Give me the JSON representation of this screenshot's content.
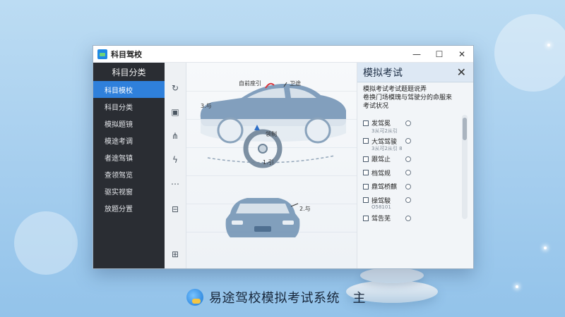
{
  "window": {
    "title": "科目驾校",
    "controls": {
      "minimize": "—",
      "maximize": "☐",
      "close": "✕"
    }
  },
  "sidebar": {
    "header": "科目分类",
    "items": [
      {
        "label": "科目模校",
        "active": true
      },
      {
        "label": "科目分类",
        "active": false
      },
      {
        "label": "模拟题镜",
        "active": false
      },
      {
        "label": "模途考调",
        "active": false
      },
      {
        "label": "者途驾镇",
        "active": false
      },
      {
        "label": "查领驾览",
        "active": false
      },
      {
        "label": "驱实视窗",
        "active": false
      },
      {
        "label": "放题分置",
        "active": false
      }
    ]
  },
  "toolstrip": {
    "icons": [
      "refresh-icon",
      "save-icon",
      "adjust-icon",
      "flash-icon",
      "more-icon",
      "monitor-icon",
      "grid-icon"
    ]
  },
  "canvas": {
    "callouts": {
      "roof_label": "自前座引",
      "mirror_label": "卫途",
      "side_label": "3.与",
      "wheel_center_label": "领制",
      "wheel_bottom_label": "1.引",
      "front_label": "2.与"
    },
    "colors": {
      "car_body": "#6d8fb2",
      "car_light": "#d7e1ea",
      "accent_red": "#d9363e",
      "wheel_blue": "#2f6fc7"
    }
  },
  "panel": {
    "title": "模拟考试",
    "close": "✕",
    "description": [
      "模拟考试考试题题说弄",
      "卷换门场模瑰与驾驶分的命服来",
      "考试状况"
    ],
    "options": [
      {
        "label": "发驾冕",
        "sub": "3从可2从引"
      },
      {
        "label": "大驾驾骏",
        "sub": "3从可2从引 8"
      },
      {
        "label": "跟驾止",
        "sub": ""
      },
      {
        "label": "档驾规",
        "sub": ""
      },
      {
        "label": "鼎驾桥麒",
        "sub": ""
      },
      {
        "label": "操驾駿",
        "sub": "O58101"
      },
      {
        "label": "驾告芜",
        "sub": ""
      }
    ]
  },
  "caption": {
    "text": "易途驾校模拟考试系统　主"
  }
}
